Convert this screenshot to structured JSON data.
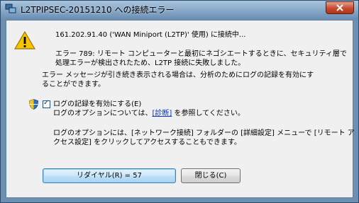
{
  "window": {
    "title": "L2TPIPSEC-20151210 への接続エラー"
  },
  "message": {
    "connection_line": "161.202.91.40 ('WAN Miniport (L2TP)' 使用) に接続中...",
    "error_line1": "エラー 789: リモート コンピューターと最初にネゴシエートするときに、セキュリティ層で",
    "error_line2": "処理エラーが検出されたため、L2TP 接続に失敗しました。",
    "advice_line1": "エラー メッセージが引き続き表示される場合は、分析のためにログの記録を有効にす",
    "advice_line2": "ることができます。"
  },
  "logging": {
    "checkbox_label": "ログの記録を有効にする(E)",
    "checked": true,
    "check_mark": "✓",
    "options_prefix": "ログのオプションについては、",
    "diagnostics_link": "[診断]",
    "options_suffix": " を参照してください。",
    "note_line1": "ログのオプションには、[ネットワーク接続] フォルダーの [詳細設定] メニューで [リモート ア",
    "note_line2": "クセス設定] をクリックしてアクセスすることもできます。"
  },
  "buttons": {
    "redial": "リダイヤル(R) = 57",
    "close": "閉じる(C)"
  },
  "colors": {
    "window_frame": "#6d8fb1",
    "close_button": "#c54a2f",
    "link": "#0033cc"
  }
}
